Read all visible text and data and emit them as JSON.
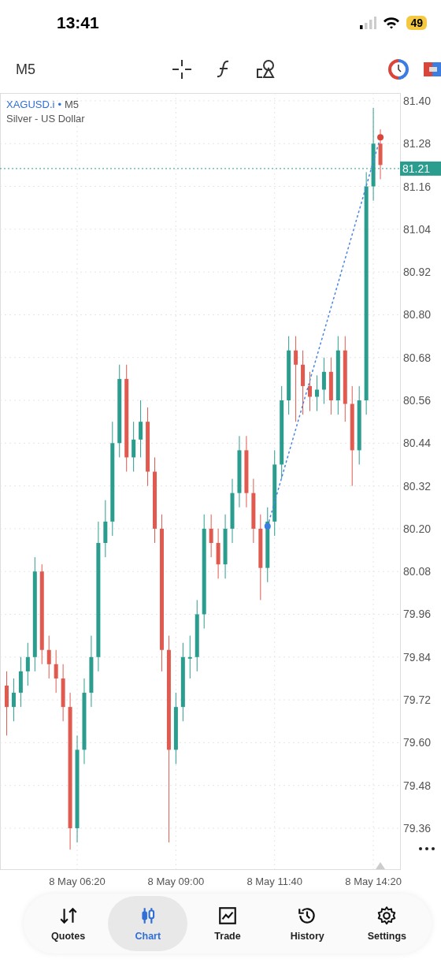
{
  "status_bar": {
    "time": "13:41",
    "battery": "49"
  },
  "toolbar": {
    "timeframe": "M5"
  },
  "chart": {
    "symbol": "XAGUSD.i",
    "separator": "•",
    "timeframe": "M5",
    "description": "Silver - US Dollar",
    "chart_data": {
      "type": "candlestick",
      "grid": true,
      "ylim": [
        79.245,
        81.422
      ],
      "yticks": [
        {
          "value": 81.4,
          "label": "81.40"
        },
        {
          "value": 81.28,
          "label": "81.28"
        },
        {
          "value": 81.16,
          "label": "81.16"
        },
        {
          "value": 81.04,
          "label": "81.04"
        },
        {
          "value": 80.92,
          "label": "80.92"
        },
        {
          "value": 80.8,
          "label": "80.80"
        },
        {
          "value": 80.68,
          "label": "80.68"
        },
        {
          "value": 80.56,
          "label": "80.56"
        },
        {
          "value": 80.44,
          "label": "80.44"
        },
        {
          "value": 80.32,
          "label": "80.32"
        },
        {
          "value": 80.2,
          "label": "80.20"
        },
        {
          "value": 80.08,
          "label": "80.08"
        },
        {
          "value": 79.96,
          "label": "79.96"
        },
        {
          "value": 79.84,
          "label": "79.84"
        },
        {
          "value": 79.72,
          "label": "79.72"
        },
        {
          "value": 79.6,
          "label": "79.60"
        },
        {
          "value": 79.48,
          "label": "79.48"
        },
        {
          "value": 79.36,
          "label": "79.36"
        }
      ],
      "categories": [
        null,
        null,
        null,
        null,
        null,
        null,
        null,
        null,
        null,
        null,
        "8 May 06:20",
        null,
        null,
        null,
        null,
        null,
        null,
        null,
        null,
        null,
        null,
        null,
        null,
        null,
        "8 May 09:00",
        null,
        null,
        null,
        null,
        null,
        null,
        null,
        null,
        null,
        null,
        null,
        null,
        null,
        "8 May 11:40",
        null,
        null,
        null,
        null,
        null,
        null,
        null,
        null,
        null,
        null,
        null,
        null,
        null,
        "8 May 14:20",
        null
      ],
      "ohlc": [
        [
          79.76,
          79.8,
          79.62,
          79.7
        ],
        [
          79.7,
          79.78,
          79.66,
          79.74
        ],
        [
          79.74,
          79.84,
          79.7,
          79.8
        ],
        [
          79.8,
          79.88,
          79.76,
          79.84
        ],
        [
          79.84,
          80.12,
          79.8,
          80.08
        ],
        [
          80.08,
          80.1,
          79.82,
          79.86
        ],
        [
          79.86,
          79.9,
          79.78,
          79.82
        ],
        [
          79.82,
          79.86,
          79.74,
          79.78
        ],
        [
          79.78,
          79.82,
          79.66,
          79.7
        ],
        [
          79.7,
          79.74,
          79.3,
          79.36
        ],
        [
          79.36,
          79.62,
          79.32,
          79.58
        ],
        [
          79.58,
          79.78,
          79.54,
          79.74
        ],
        [
          79.74,
          79.9,
          79.7,
          79.84
        ],
        [
          79.84,
          80.22,
          79.8,
          80.16
        ],
        [
          80.16,
          80.28,
          80.12,
          80.22
        ],
        [
          80.22,
          80.5,
          80.18,
          80.44
        ],
        [
          80.44,
          80.66,
          80.4,
          80.62
        ],
        [
          80.62,
          80.66,
          80.36,
          80.4
        ],
        [
          80.4,
          80.5,
          80.36,
          80.45
        ],
        [
          80.45,
          80.56,
          80.4,
          80.5
        ],
        [
          80.5,
          80.54,
          80.32,
          80.36
        ],
        [
          80.36,
          80.4,
          80.16,
          80.2
        ],
        [
          80.2,
          80.24,
          79.8,
          79.86
        ],
        [
          79.86,
          79.9,
          79.32,
          79.58
        ],
        [
          79.58,
          79.74,
          79.54,
          79.7
        ],
        [
          79.7,
          79.88,
          79.66,
          79.84
        ],
        [
          79.84,
          79.9,
          79.78,
          79.84
        ],
        [
          79.84,
          80.0,
          79.8,
          79.96
        ],
        [
          79.96,
          80.24,
          79.92,
          80.2
        ],
        [
          80.2,
          80.24,
          80.12,
          80.16
        ],
        [
          80.16,
          80.2,
          80.06,
          80.1
        ],
        [
          80.1,
          80.24,
          80.06,
          80.2
        ],
        [
          80.2,
          80.34,
          80.16,
          80.3
        ],
        [
          80.3,
          80.46,
          80.26,
          80.42
        ],
        [
          80.42,
          80.46,
          80.26,
          80.3
        ],
        [
          80.3,
          80.34,
          80.16,
          80.2
        ],
        [
          80.2,
          80.24,
          80.0,
          80.09
        ],
        [
          80.09,
          80.26,
          80.05,
          80.22
        ],
        [
          80.22,
          80.42,
          80.18,
          80.38
        ],
        [
          80.38,
          80.6,
          80.34,
          80.56
        ],
        [
          80.56,
          80.74,
          80.52,
          80.7
        ],
        [
          80.7,
          80.74,
          80.5,
          80.66
        ],
        [
          80.66,
          80.7,
          80.52,
          80.6
        ],
        [
          80.6,
          80.64,
          80.53,
          80.57
        ],
        [
          80.57,
          80.63,
          80.53,
          80.59
        ],
        [
          80.59,
          80.68,
          80.55,
          80.64
        ],
        [
          80.64,
          80.68,
          80.52,
          80.56
        ],
        [
          80.56,
          80.74,
          80.52,
          80.7
        ],
        [
          80.7,
          80.74,
          80.5,
          80.55
        ],
        [
          80.55,
          80.6,
          80.32,
          80.42
        ],
        [
          80.42,
          80.6,
          80.38,
          80.56
        ],
        [
          80.56,
          81.2,
          80.52,
          81.16
        ],
        [
          81.16,
          81.38,
          81.12,
          81.28
        ],
        [
          81.28,
          81.32,
          81.18,
          81.22
        ]
      ],
      "ref_lines": [
        {
          "axis": "y",
          "value": 81.21,
          "label": "81.21"
        }
      ]
    }
  },
  "nav": [
    {
      "label": "Quotes",
      "kind": "quotes",
      "selected": false
    },
    {
      "label": "Chart",
      "kind": "chart",
      "selected": true
    },
    {
      "label": "Trade",
      "kind": "trade",
      "selected": false
    },
    {
      "label": "History",
      "kind": "history",
      "selected": false
    },
    {
      "label": "Settings",
      "kind": "settings",
      "selected": false
    }
  ]
}
